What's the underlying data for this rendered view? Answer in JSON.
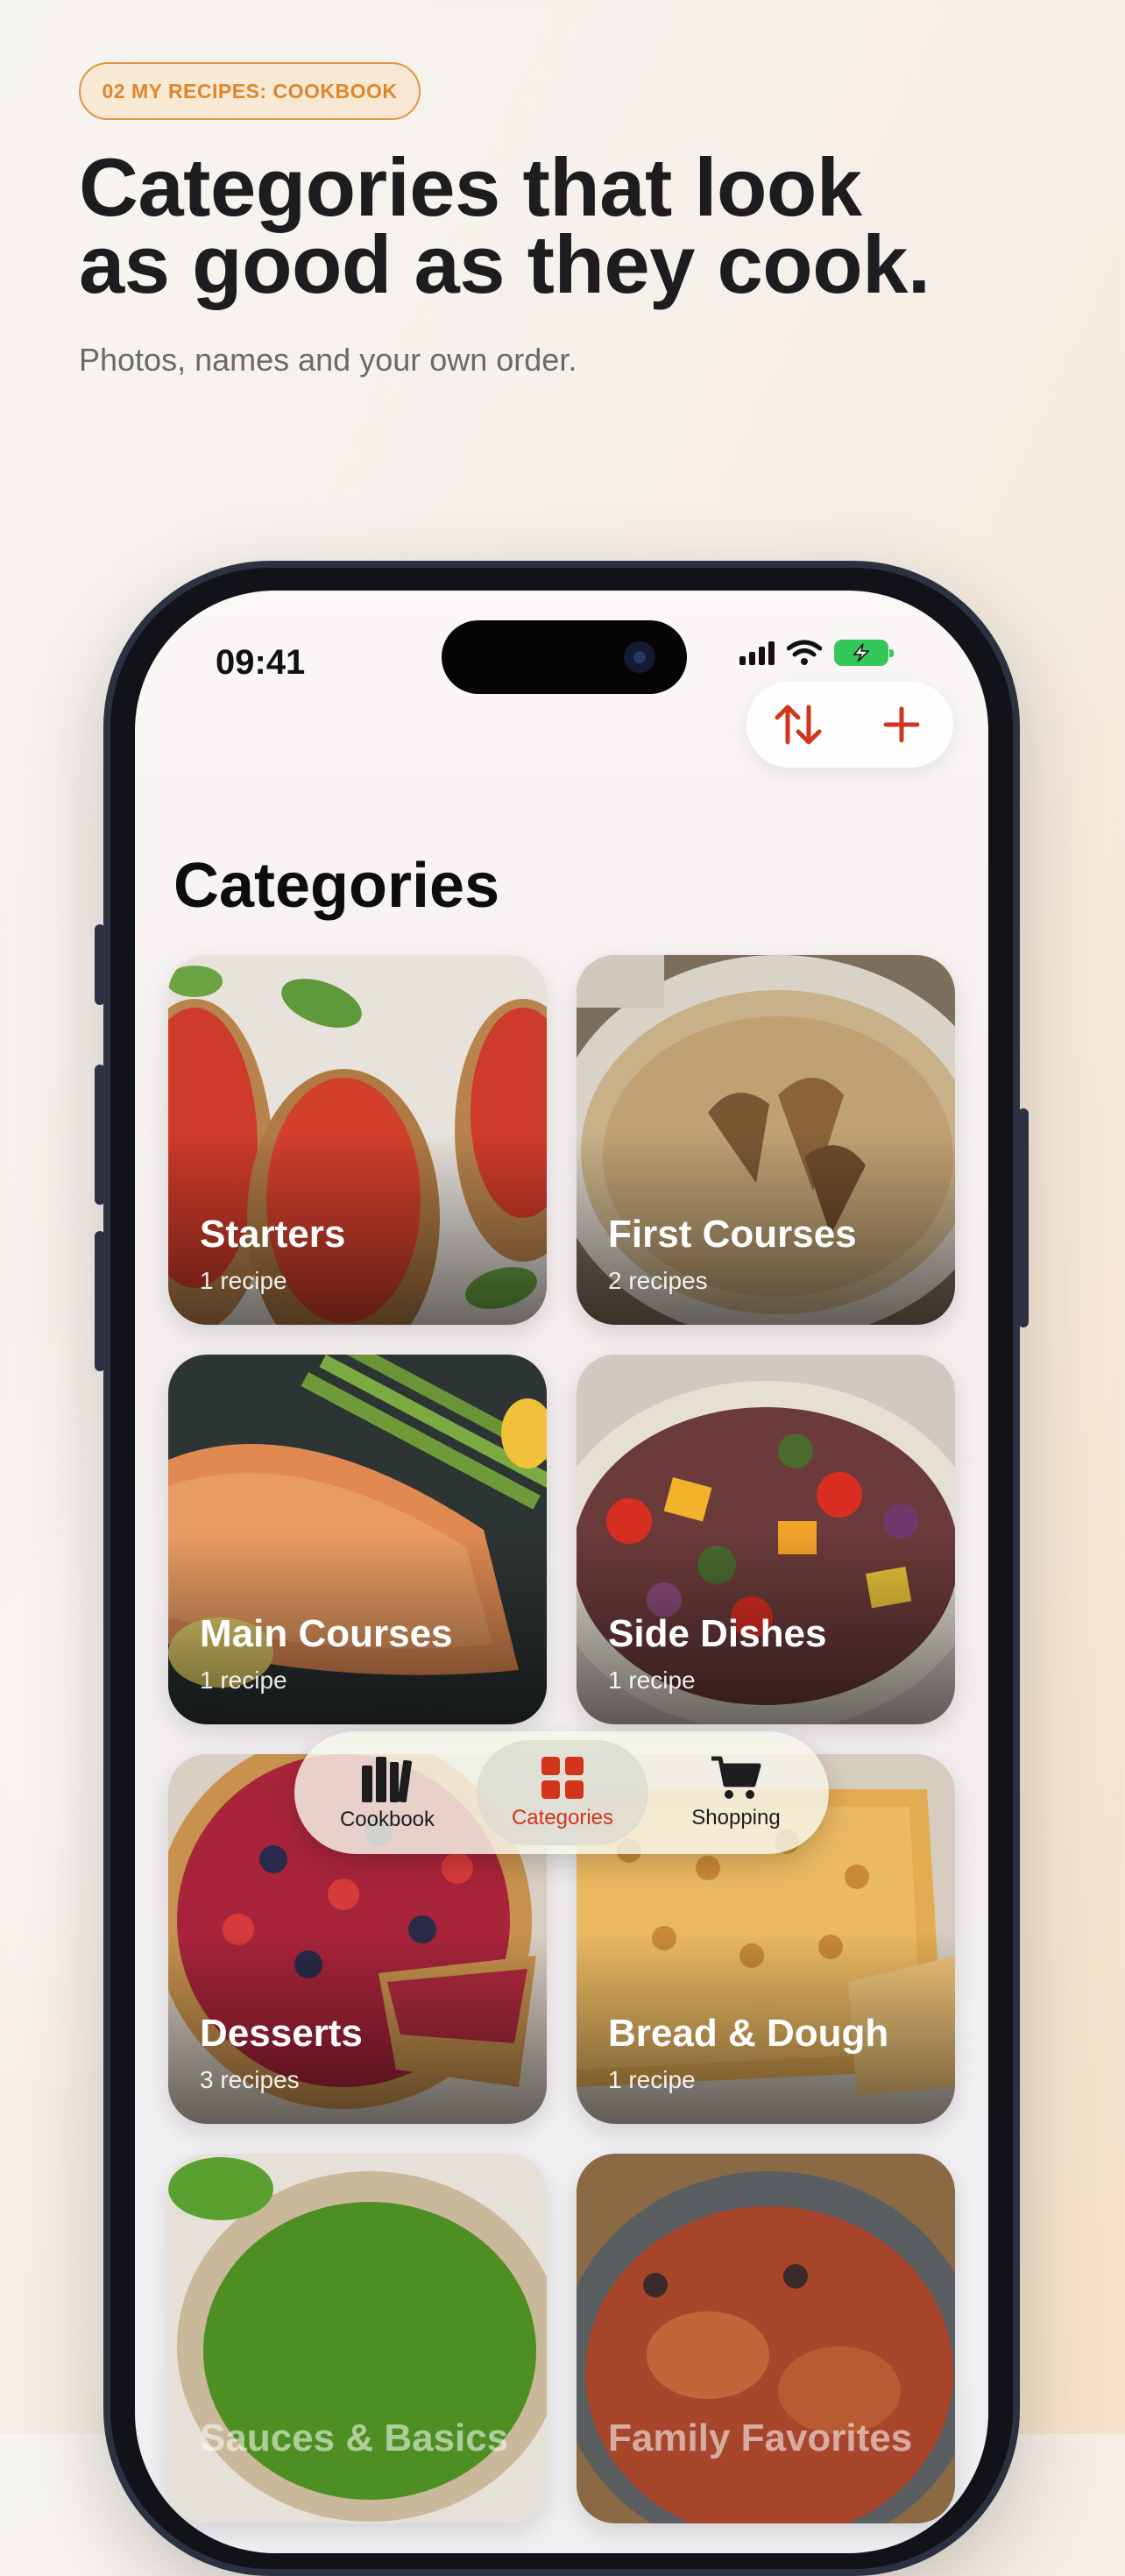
{
  "promo": {
    "tag": "02  MY RECIPES: COOKBOOK",
    "headline_line1": "Categories that look",
    "headline_line2": "as good as they cook.",
    "subtitle": "Photos, names and your own order."
  },
  "status_bar": {
    "time": "09:41",
    "icons": [
      "cellular-signal-icon",
      "wifi-icon",
      "battery-charging-icon"
    ]
  },
  "toolbar": {
    "buttons": [
      {
        "icon": "sort-arrows-icon"
      },
      {
        "icon": "plus-icon"
      }
    ],
    "accent_color": "#d2351c"
  },
  "page": {
    "title": "Categories"
  },
  "categories": [
    {
      "name": "Starters",
      "count": "1 recipe"
    },
    {
      "name": "First Courses",
      "count": "2 recipes"
    },
    {
      "name": "Main Courses",
      "count": "1 recipe"
    },
    {
      "name": "Side Dishes",
      "count": "1 recipe"
    },
    {
      "name": "Desserts",
      "count": "3 recipes"
    },
    {
      "name": "Bread & Dough",
      "count": "1 recipe"
    },
    {
      "name": "Sauces & Basics",
      "count": ""
    },
    {
      "name": "Family Favorites",
      "count": ""
    }
  ],
  "tab_bar": {
    "tabs": [
      {
        "label": "Cookbook",
        "icon": "books-icon",
        "active": false
      },
      {
        "label": "Categories",
        "icon": "grid-icon",
        "active": true
      },
      {
        "label": "Shopping",
        "icon": "cart-icon",
        "active": false
      }
    ]
  }
}
